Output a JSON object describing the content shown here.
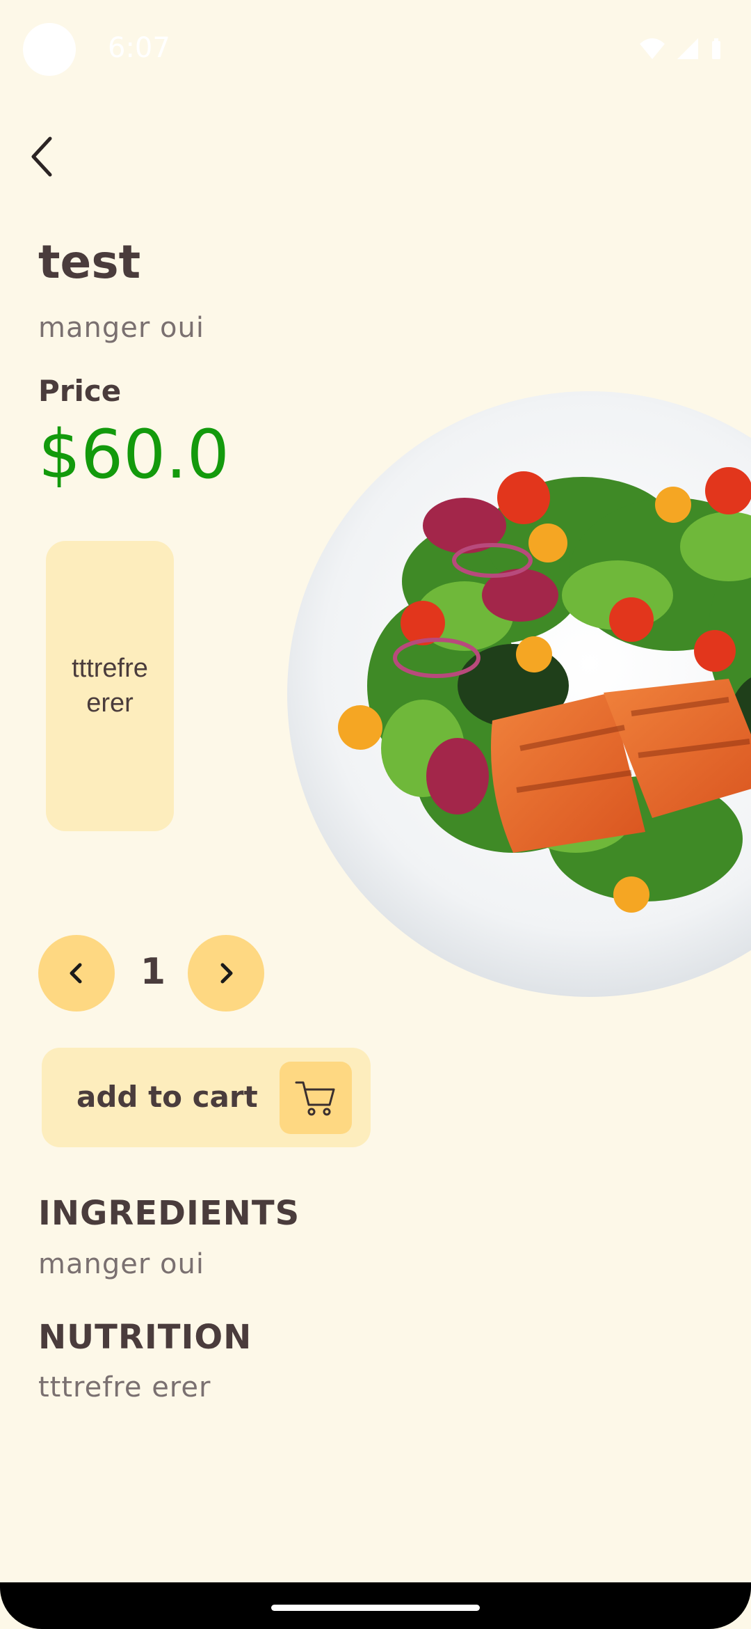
{
  "status_bar": {
    "time": "6:07",
    "icons": [
      "wifi-icon",
      "signal-icon",
      "battery-icon"
    ]
  },
  "nav": {
    "back_icon": "back-arrow-icon"
  },
  "product": {
    "title": "test",
    "subtitle": "manger oui",
    "price_label": "Price",
    "price": "$60.0",
    "image": "salmon salad plate"
  },
  "tag": {
    "text": "tttrefre erer"
  },
  "quantity": {
    "value": "1",
    "decrease_icon": "chevron-left-icon",
    "increase_icon": "chevron-right-icon"
  },
  "cart": {
    "label": "add to cart",
    "icon": "cart-icon"
  },
  "ingredients": {
    "heading": "INGREDIENTS",
    "text": "manger oui"
  },
  "nutrition": {
    "heading": "NUTRITION",
    "text": "tttrefre erer"
  },
  "colors": {
    "background": "#fdf8e8",
    "accent_light": "#fdedbd",
    "accent": "#fed882",
    "price": "#139a0c",
    "text_dark": "#4a3c3c",
    "text_muted": "#7a7070"
  }
}
